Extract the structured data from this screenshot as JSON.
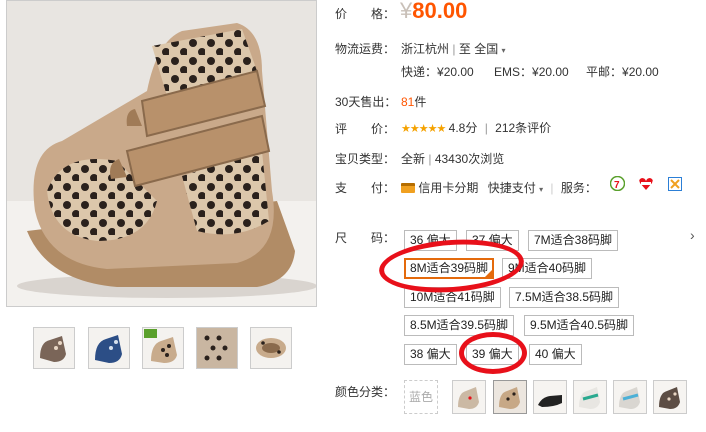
{
  "price": {
    "label": "价　　格：",
    "symbol": "¥",
    "value": "80.00"
  },
  "shipping": {
    "label": "物流运费：",
    "from": "浙江杭州",
    "sep": "|",
    "to_prefix": "至",
    "to": "全国",
    "rates": [
      {
        "name": "快递：",
        "value": "¥20.00"
      },
      {
        "name": "EMS：",
        "value": "¥20.00"
      },
      {
        "name": "平邮：",
        "value": "¥20.00"
      }
    ]
  },
  "sold": {
    "label": "30天售出：",
    "count": "81",
    "unit": "件"
  },
  "rating": {
    "label": "评　　价：",
    "stars": 5,
    "score": "4.8分",
    "sep": "|",
    "reviews": "212条评价"
  },
  "item_type": {
    "label": "宝贝类型：",
    "condition": "全新",
    "sep": "|",
    "views": "43430次浏览"
  },
  "payment": {
    "label": "支　　付：",
    "credit": "信用卡分期",
    "quick": "快捷支付",
    "service_label": "服务："
  },
  "sizes": {
    "label": "尺　　码：",
    "more_arrow": "›",
    "options": [
      "36 偏大",
      "37 偏大",
      "7M适合38码脚",
      "8M适合39码脚",
      "9M适合40码脚",
      "10M适合41码脚",
      "7.5M适合38.5码脚",
      "8.5M适合39.5码脚",
      "9.5M适合40.5码脚",
      "38 偏大",
      "39 偏大",
      "40 偏大"
    ],
    "selected_index": 3
  },
  "colors": {
    "label": "颜色分类：",
    "text_swatch": "蓝色"
  },
  "theme": {
    "price_color": "#ff5500",
    "accent": "#e46a0c",
    "annotation": "#e8101a",
    "star_color": "#f5a200"
  }
}
